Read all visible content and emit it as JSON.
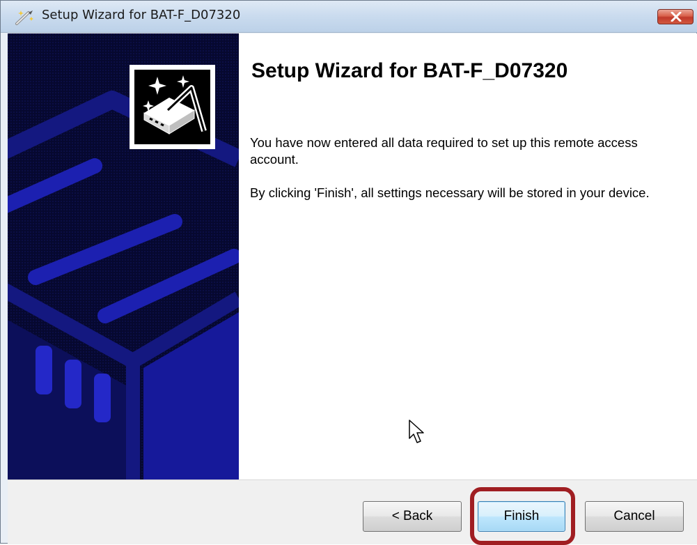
{
  "window": {
    "title": "Setup Wizard for BAT-F_D07320",
    "icons": {
      "app": "wizard-wand-icon",
      "close": "close-icon",
      "banner": "device-banner-graphic",
      "logo": "wizard-device-icon",
      "cursor": "mouse-pointer-icon"
    }
  },
  "content": {
    "heading": "Setup Wizard for BAT-F_D07320",
    "paragraph1": "You have now entered all data required to set up this remote access account.",
    "paragraph2": "By clicking 'Finish', all settings necessary will be stored in your device."
  },
  "buttons": {
    "back": "< Back",
    "finish": "Finish",
    "cancel": "Cancel"
  },
  "colors": {
    "banner": "#06082f",
    "banner_shapes": "#1b1f9e",
    "highlight": "#a01e22",
    "close": "#c0392b"
  }
}
